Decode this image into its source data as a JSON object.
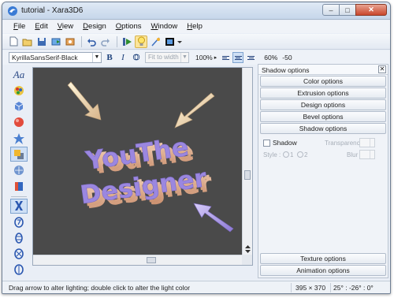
{
  "window": {
    "title": "tutorial - Xara3D6",
    "minimize_glyph": "–",
    "maximize_glyph": "□",
    "close_glyph": "✕"
  },
  "menu": [
    {
      "label": "File",
      "accel": "F",
      "rest": "ile"
    },
    {
      "label": "Edit",
      "accel": "E",
      "rest": "dit"
    },
    {
      "label": "View",
      "accel": "V",
      "rest": "iew"
    },
    {
      "label": "Design",
      "accel": "D",
      "rest": "esign"
    },
    {
      "label": "Options",
      "accel": "O",
      "rest": "ptions"
    },
    {
      "label": "Window",
      "accel": "W",
      "rest": "indow"
    },
    {
      "label": "Help",
      "accel": "H",
      "rest": "elp"
    }
  ],
  "toolbar": {
    "icons": [
      "new-icon",
      "open-icon",
      "save-icon",
      "export-icon",
      "import-icon",
      "undo-icon",
      "redo-icon",
      "animation-icon",
      "lighting-icon",
      "antialias-icon",
      "view-mode-icon"
    ]
  },
  "format_bar": {
    "font_name": "KyrillaSansSerif-Black",
    "bold_label": "B",
    "italic_label": "I",
    "outline_label": "O",
    "fit_placeholder": "Fit to width",
    "zoom": "100%",
    "zoom_arrow": "▸",
    "line_spacing": "60%",
    "char_spacing": "-50"
  },
  "scene": {
    "line1": "YouThe",
    "line2": "Designer",
    "background_color": "#4a4a4a",
    "text_face_color": "#9b87e0",
    "extrusion_color": "#e6b79a"
  },
  "side_panel": {
    "title": "Shadow options",
    "close_glyph": "✕",
    "buttons_top": [
      "Color options",
      "Extrusion options",
      "Design options",
      "Bevel options",
      "Shadow options"
    ],
    "shadow": {
      "checkbox_label": "Shadow",
      "transparency_label": "Transparency",
      "style_label": "Style :",
      "style_1": "1",
      "style_2": "2",
      "blur_label": "Blur"
    },
    "buttons_bottom": [
      "Texture options",
      "Animation options"
    ]
  },
  "status": {
    "message": "Drag arrow to alter lighting; double click to alter the light color",
    "size": "395 × 370",
    "angles": "25° : -26° : 0°"
  },
  "left_tools": [
    "text-tool-icon",
    "color-tool-icon",
    "extrude-tool-icon",
    "sphere-icon",
    "star-icon",
    "shadow-tool-icon",
    "texture-icon",
    "bevel-icon",
    "anim-x-icon",
    "anim-rotate-1-icon",
    "anim-rotate-2-icon",
    "anim-rotate-3-icon",
    "anim-rotate-4-icon"
  ]
}
